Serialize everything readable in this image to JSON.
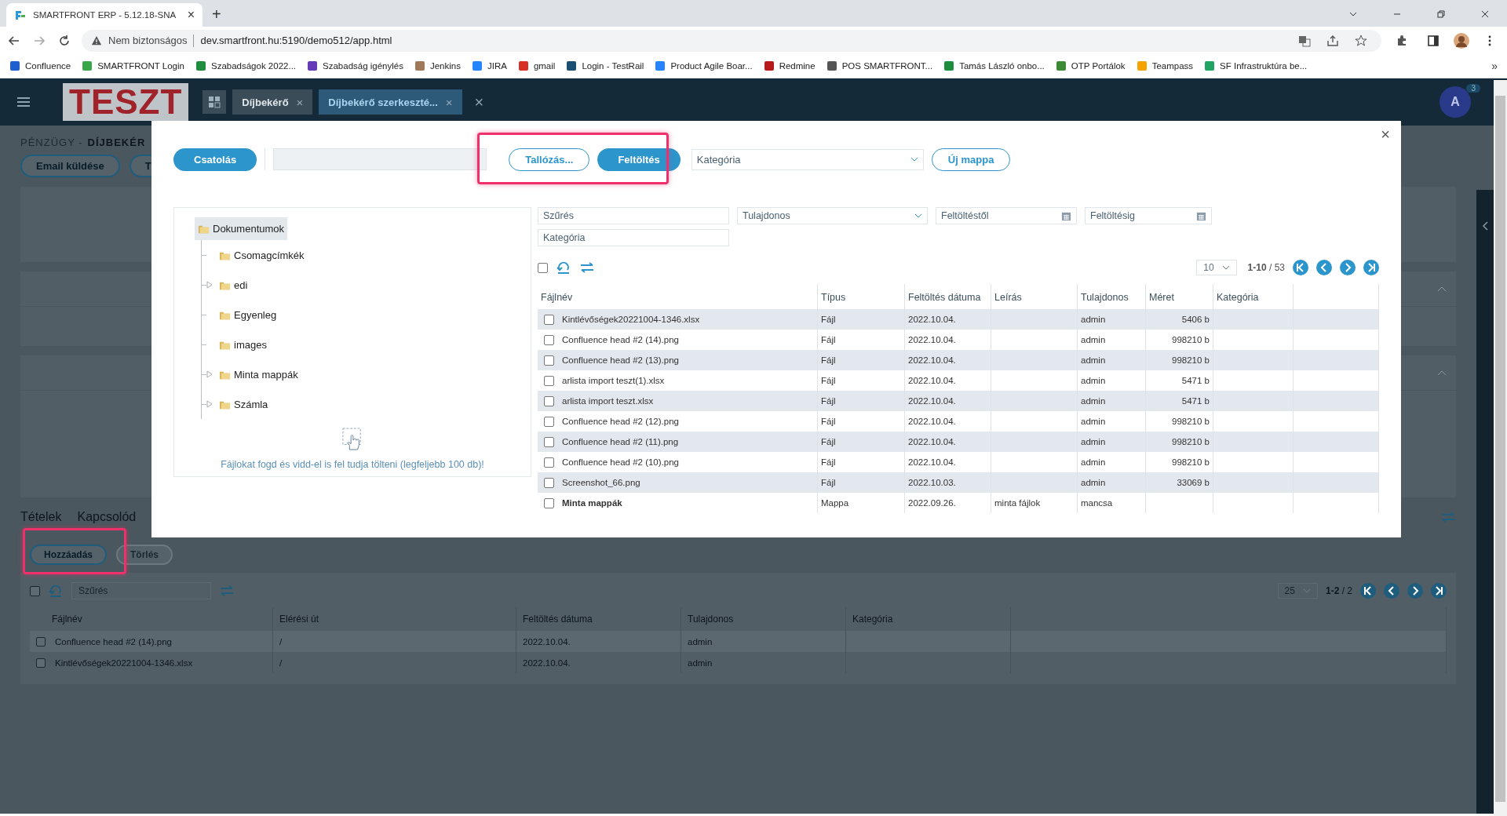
{
  "browser": {
    "tab": {
      "title": "SMARTFRONT ERP - 5.12.18-SNA",
      "close": "×"
    },
    "new_tab": "+",
    "security": "Nem biztonságos",
    "url": "dev.smartfront.hu:5190/demo512/app.html",
    "bookmarks": [
      {
        "label": "Confluence",
        "color": "#1d5fd0"
      },
      {
        "label": "SMARTFRONT Login",
        "color": "#3aa64a"
      },
      {
        "label": "Szabadságok 2022...",
        "color": "#1e8e3e"
      },
      {
        "label": "Szabadság igénylés",
        "color": "#673ab7"
      },
      {
        "label": "Jenkins",
        "color": "#a0785a"
      },
      {
        "label": "JIRA",
        "color": "#2684ff"
      },
      {
        "label": "gmail",
        "color": "#d93025"
      },
      {
        "label": "Login - TestRail",
        "color": "#1b4f72"
      },
      {
        "label": "Product Agile Boar...",
        "color": "#2684ff"
      },
      {
        "label": "Redmine",
        "color": "#b71c1c"
      },
      {
        "label": "POS SMARTFRONT...",
        "color": "#555555"
      },
      {
        "label": "Tamás László onbo...",
        "color": "#1e8e3e"
      },
      {
        "label": "OTP Portálok",
        "color": "#3d8b37"
      },
      {
        "label": "Teampass",
        "color": "#f4a300"
      },
      {
        "label": "SF Infrastruktúra be...",
        "color": "#1fa463"
      }
    ],
    "more": "»"
  },
  "app": {
    "logo": "TESZT",
    "tabs": [
      {
        "label": "Díjbekérő",
        "close": "×",
        "selected": false
      },
      {
        "label": "Díjbekérő szerkeszté...",
        "close": "×",
        "selected": true
      }
    ],
    "close_all": "×",
    "avatar": {
      "initial": "A",
      "badge": "3"
    }
  },
  "page": {
    "breadcrumb": {
      "section": "PÉNZÜGY -",
      "current": "DÍJBEKÉR"
    },
    "buttons": [
      "Email küldése",
      "T"
    ],
    "detail_tabs": [
      "Tételek",
      "Kapcsolód"
    ],
    "actions": [
      {
        "label": "Hozzáadás",
        "disabled": false
      },
      {
        "label": "Törlés",
        "disabled": true
      }
    ],
    "select_all": {
      "checked": false
    },
    "filter": {
      "placeholder": "Szűrés"
    },
    "page_size": "25",
    "range": "1-2",
    "total": "/ 2",
    "columns": [
      "Fájlnév",
      "Elérési út",
      "Feltöltés dátuma",
      "Tulajdonos",
      "Kategória"
    ],
    "rows": [
      {
        "name": "Confluence head #2 (14).png",
        "path": "/",
        "date": "2022.10.04.",
        "owner": "admin",
        "checked": false
      },
      {
        "name": "Kintlévőségek20221004-1346.xlsx",
        "path": "/",
        "date": "2022.10.04.",
        "owner": "admin",
        "checked": false
      }
    ]
  },
  "dialog": {
    "close": "×",
    "attach": "Csatolás",
    "browse": "Tallózás...",
    "upload": "Feltöltés",
    "category": {
      "placeholder": "Kategória"
    },
    "new_folder": "Új mappa",
    "tree": [
      {
        "label": "Dokumentumok",
        "selected": true,
        "children": [
          {
            "label": "Csomagcímkék",
            "selected": false,
            "kind": "leaf"
          },
          {
            "label": "edi",
            "selected": false,
            "kind": "branch"
          },
          {
            "label": "Egyenleg",
            "selected": false,
            "kind": "leaf"
          },
          {
            "label": "images",
            "selected": false,
            "kind": "leaf"
          },
          {
            "label": "Minta mappák",
            "selected": false,
            "kind": "branch"
          },
          {
            "label": "Számla",
            "selected": false,
            "kind": "branch"
          }
        ]
      }
    ],
    "drop_hint": "Fájlokat fogd és vidd-el is fel tudja tölteni (legfeljebb 100 db)!",
    "filters": [
      {
        "placeholder": "Szűrés",
        "kind": "text"
      },
      {
        "placeholder": "Tulajdonos",
        "kind": "select"
      },
      {
        "placeholder": "Feltöltéstől",
        "kind": "date"
      },
      {
        "placeholder": "Feltöltésig",
        "kind": "date"
      },
      {
        "placeholder": "Kategória",
        "kind": "text"
      }
    ],
    "select_all": {
      "checked": false
    },
    "page_size": "10",
    "range": "1-10",
    "total": "/ 53",
    "columns": [
      "Fájlnév",
      "Típus",
      "Feltöltés dátuma",
      "Leírás",
      "Tulajdonos",
      "Méret",
      "Kategória"
    ],
    "rows": [
      {
        "name": "Kintlévőségek20221004-1346.xlsx",
        "type": "Fájl",
        "date": "2022.10.04.",
        "owner": "admin",
        "size": "5406 b",
        "kind": "file",
        "checked": false
      },
      {
        "name": "Confluence head #2 (14).png",
        "type": "Fájl",
        "date": "2022.10.04.",
        "owner": "admin",
        "size": "998210 b",
        "kind": "file",
        "checked": false
      },
      {
        "name": "Confluence head #2 (13).png",
        "type": "Fájl",
        "date": "2022.10.04.",
        "owner": "admin",
        "size": "998210 b",
        "kind": "file",
        "checked": false
      },
      {
        "name": "arlista import teszt(1).xlsx",
        "type": "Fájl",
        "date": "2022.10.04.",
        "owner": "admin",
        "size": "5471 b",
        "kind": "file",
        "checked": false
      },
      {
        "name": "arlista import teszt.xlsx",
        "type": "Fájl",
        "date": "2022.10.04.",
        "owner": "admin",
        "size": "5471 b",
        "kind": "file",
        "checked": false
      },
      {
        "name": "Confluence head #2 (12).png",
        "type": "Fájl",
        "date": "2022.10.04.",
        "owner": "admin",
        "size": "998210 b",
        "kind": "file",
        "checked": false
      },
      {
        "name": "Confluence head #2 (11).png",
        "type": "Fájl",
        "date": "2022.10.04.",
        "owner": "admin",
        "size": "998210 b",
        "kind": "file",
        "checked": false
      },
      {
        "name": "Confluence head #2 (10).png",
        "type": "Fájl",
        "date": "2022.10.04.",
        "owner": "admin",
        "size": "998210 b",
        "kind": "file",
        "checked": false
      },
      {
        "name": "Screenshot_66.png",
        "type": "Fájl",
        "date": "2022.10.03.",
        "owner": "admin",
        "size": "33069 b",
        "kind": "file",
        "checked": false
      },
      {
        "name": "Minta mappák",
        "type": "Mappa",
        "date": "2022.09.26.",
        "description": "minta fájlok",
        "owner": "mancsa",
        "kind": "folder",
        "checked": false
      }
    ]
  }
}
